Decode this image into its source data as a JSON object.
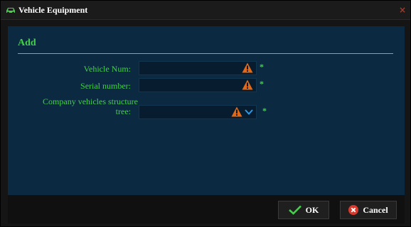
{
  "window": {
    "title": "Vehicle Equipment",
    "close_label": "×"
  },
  "form": {
    "section_title": "Add",
    "fields": [
      {
        "label": "Vehicle Num:",
        "value": "",
        "required_mark": "*"
      },
      {
        "label": "Serial number:",
        "value": "",
        "required_mark": "*"
      },
      {
        "label_line1": "Company vehicles structure",
        "label_line2": "tree:",
        "value": "",
        "required_mark": "*"
      }
    ]
  },
  "buttons": {
    "ok_label": "OK",
    "cancel_label": "Cancel"
  },
  "colors": {
    "accent_green": "#44d04a",
    "warning_orange": "#e06a1a",
    "panel_blue": "#0b2941",
    "cancel_red": "#d93a2e",
    "chevron_blue": "#2b9be6"
  }
}
